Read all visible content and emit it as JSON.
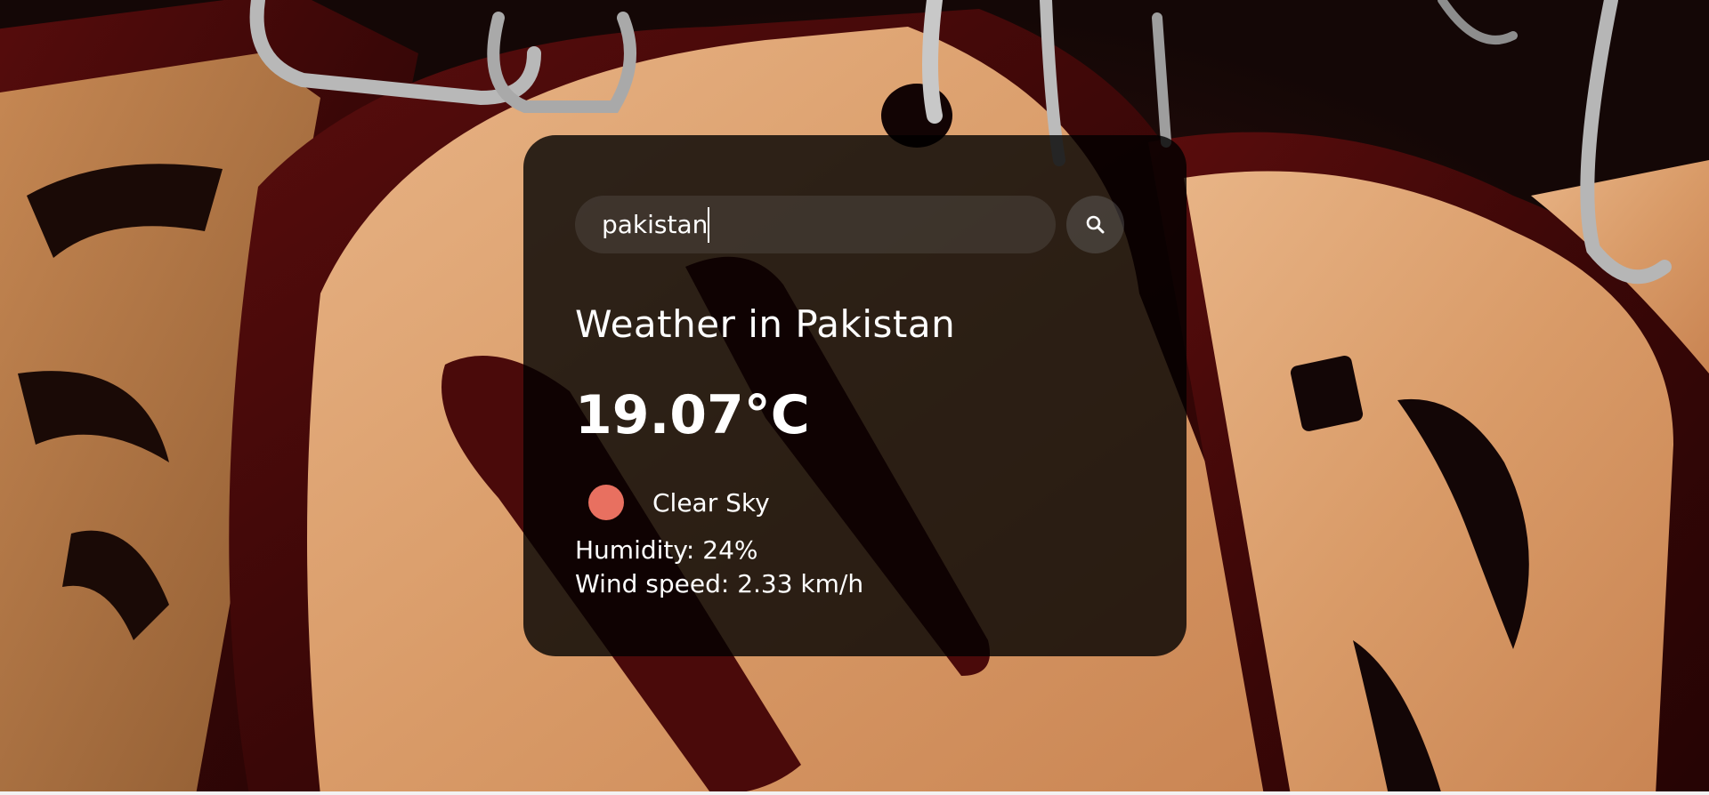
{
  "search": {
    "value": "pakistan",
    "placeholder": "Search"
  },
  "icons": {
    "search_button": "search-icon",
    "weather_condition": "clear-sky-icon"
  },
  "weather": {
    "city_heading": "Weather in Pakistan",
    "temperature": "19.07°C",
    "description": "Clear Sky",
    "humidity": "Humidity: 24%",
    "wind_speed": "Wind speed: 2.33 km/h"
  },
  "colors": {
    "condition_dot": "#e87060",
    "card_overlay": "rgba(0,0,0,0.8)",
    "text": "#ffffff"
  }
}
